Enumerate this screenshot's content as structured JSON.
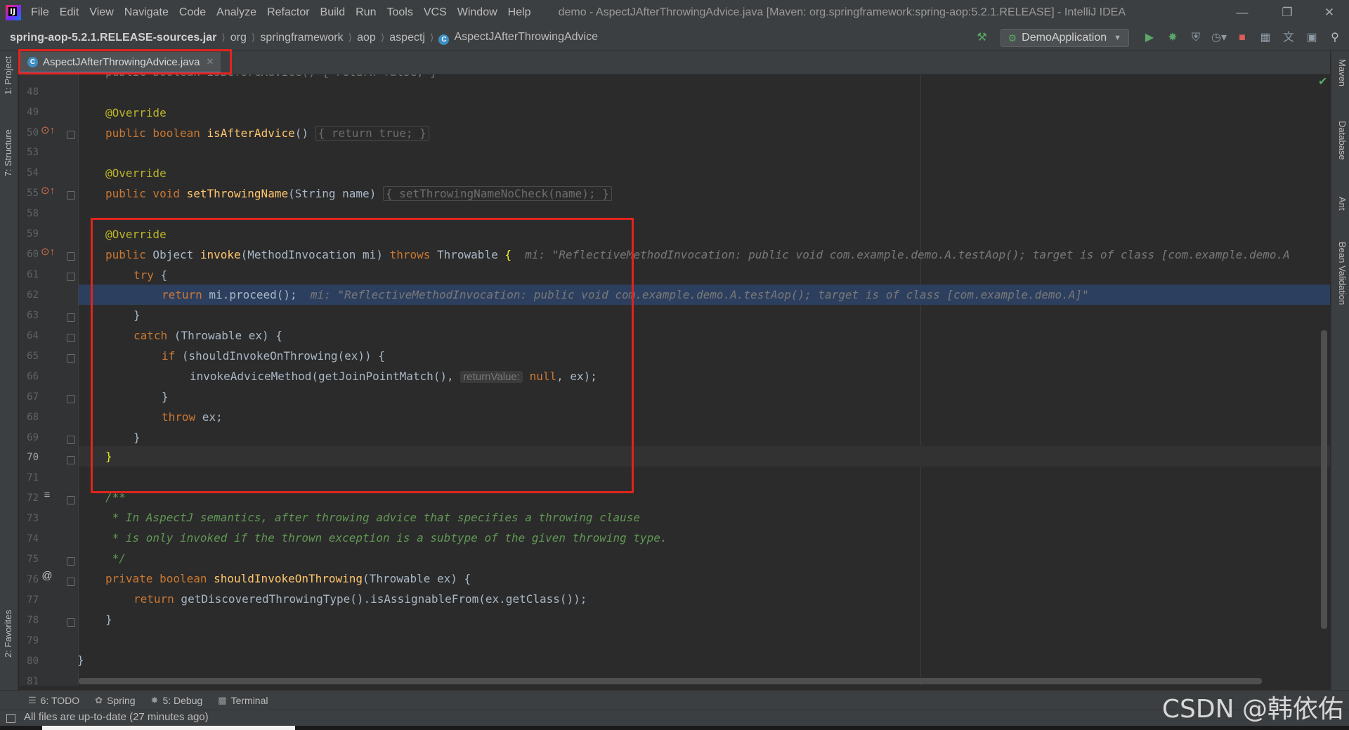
{
  "menu": {
    "logo": "IJ",
    "items": [
      "File",
      "Edit",
      "View",
      "Navigate",
      "Code",
      "Analyze",
      "Refactor",
      "Build",
      "Run",
      "Tools",
      "VCS",
      "Window",
      "Help"
    ],
    "window_title": "demo - AspectJAfterThrowingAdvice.java [Maven: org.springframework:spring-aop:5.2.1.RELEASE] - IntelliJ IDEA"
  },
  "breadcrumb": [
    "spring-aop-5.2.1.RELEASE-sources.jar",
    "org",
    "springframework",
    "aop",
    "aspectj",
    "AspectJAfterThrowingAdvice"
  ],
  "run_config": "DemoApplication",
  "tool_windows_left": [
    "1: Project",
    "7: Structure",
    "2: Favorites"
  ],
  "tool_windows_right": [
    "Maven",
    "Database",
    "Ant",
    "Bean Validation"
  ],
  "editor_tab": {
    "label": "AspectJAfterThrowingAdvice.java",
    "icon": "class-icon"
  },
  "editor": {
    "line_numbers": [
      "48",
      "49",
      "50",
      "53",
      "54",
      "55",
      "58",
      "59",
      "60",
      "61",
      "62",
      "63",
      "64",
      "65",
      "66",
      "67",
      "68",
      "69",
      "70",
      "71",
      "72",
      "73",
      "74",
      "75",
      "76",
      "77",
      "78",
      "79",
      "80",
      "81"
    ],
    "current_line": "70",
    "partial_top_line": "public boolean isBeforeAdvice() { return false; }",
    "lines": {
      "l49": "@Override",
      "l50_a": "public boolean ",
      "l50_fn": "isAfterAdvice",
      "l50_b": "() ",
      "l50_body": "{ return true; }",
      "l54": "@Override",
      "l55_a": "public void ",
      "l55_fn": "setThrowingName",
      "l55_b": "(String name) ",
      "l55_body": "{ setThrowingNameNoCheck(name); }",
      "l59": "@Override",
      "l60_kw": "public",
      "l60_a": " Object ",
      "l60_fn": "invoke",
      "l60_b": "(MethodInvocation mi) ",
      "l60_kw2": "throws",
      "l60_c": " Throwable ",
      "l60_brace": "{",
      "l60_hint": "mi: \"ReflectiveMethodInvocation: public void com.example.demo.A.testAop(); target is of class [com.example.demo.A",
      "l61_kw": "try",
      "l61_a": " {",
      "l62_kw": "return",
      "l62_a": " mi.proceed();",
      "l62_hint": "mi: \"ReflectiveMethodInvocation: public void com.example.demo.A.testAop(); target is of class [com.example.demo.A]\"",
      "l63": "}",
      "l64_kw": "catch",
      "l64_a": " (Throwable ex) {",
      "l65_kw": "if",
      "l65_a": " (shouldInvokeOnThrowing(ex)) {",
      "l66_a": "invokeAdviceMethod(getJoinPointMatch(), ",
      "l66_param": "returnValue:",
      "l66_kw": "null",
      "l66_b": ", ex);",
      "l67": "}",
      "l68_kw": "throw",
      "l68_a": " ex;",
      "l69": "}",
      "l70": "}",
      "l72": "/**",
      "l73": " * In AspectJ semantics, after throwing advice that specifies a throwing clause",
      "l74": " * is only invoked if the thrown exception is a subtype of the given throwing type.",
      "l75": " */",
      "l76_kw": "private boolean ",
      "l76_fn": "shouldInvokeOnThrowing",
      "l76_a": "(Throwable ex) {",
      "l77_kw": "return",
      "l77_a": " getDiscoveredThrowingType().isAssignableFrom(ex.getClass());",
      "l78": "}",
      "l80": "}"
    }
  },
  "bottom_tabs": [
    {
      "icon": "todo-icon",
      "label": "6: TODO"
    },
    {
      "icon": "spring-icon",
      "label": "Spring"
    },
    {
      "icon": "debug-icon",
      "label": "5: Debug"
    },
    {
      "icon": "terminal-icon",
      "label": "Terminal"
    }
  ],
  "status": {
    "message": "All files are up-to-date (27 minutes ago)"
  },
  "watermark": "CSDN @韩依佑",
  "colors": {
    "highlight_box": "#e0241d",
    "exec_line": "#2d3f5e",
    "keyword": "#cc7832",
    "annotation": "#bbb529",
    "method": "#ffc66d"
  }
}
